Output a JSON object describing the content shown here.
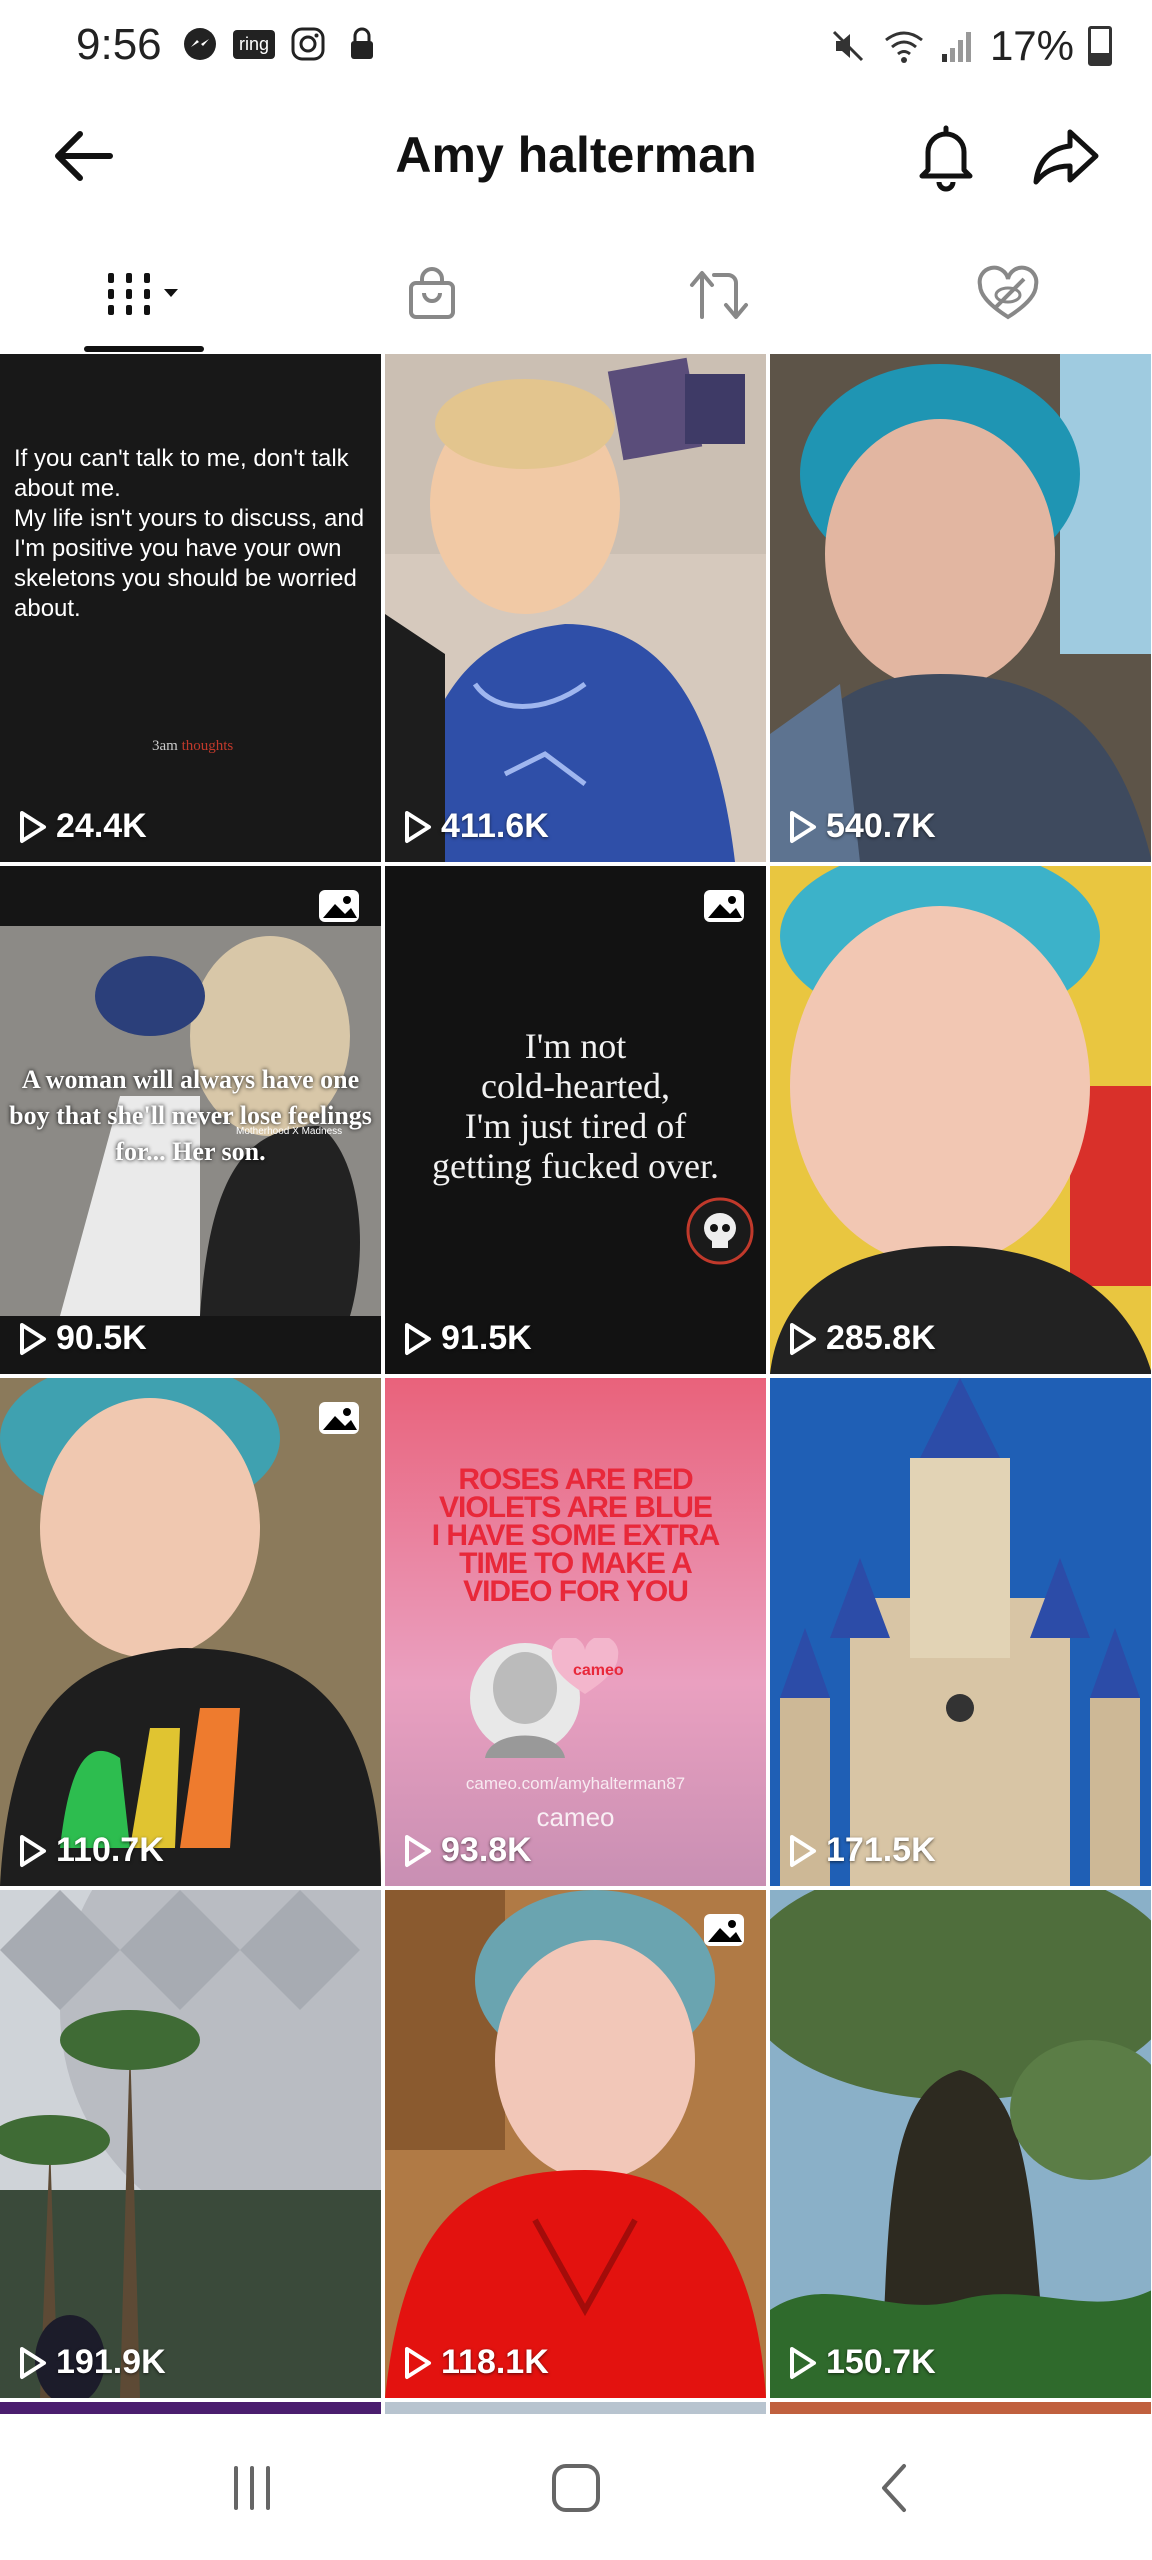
{
  "status_bar": {
    "time": "9:56",
    "ring_label": "ring",
    "battery": "17%"
  },
  "header": {
    "title": "Amy halterman"
  },
  "tabs": [
    {
      "name": "videos",
      "icon": "grid-icon"
    },
    {
      "name": "shop",
      "icon": "shopping-bag-icon"
    },
    {
      "name": "reposts",
      "icon": "repost-icon"
    },
    {
      "name": "liked",
      "icon": "hidden-heart-icon"
    }
  ],
  "posts": [
    {
      "views": "24.4K",
      "text": "If you can't talk to me, don't talk about me.\nMy life isn't yours to discuss, and I'm positive you have your own skeletons you should be worried about.",
      "watermark": "3am",
      "watermark_accent": "thoughts"
    },
    {
      "views": "411.6K"
    },
    {
      "views": "540.7K"
    },
    {
      "views": "90.5K",
      "photo": true,
      "text": "A woman will always have one boy that she'll never lose feelings for... Her son.",
      "watermark": "Motherhood X Madness"
    },
    {
      "views": "91.5K",
      "photo": true,
      "text": "I'm not\ncold-hearted,\nI'm just tired of\ngetting fucked over."
    },
    {
      "views": "285.8K"
    },
    {
      "views": "110.7K",
      "photo": true
    },
    {
      "views": "93.8K",
      "text": "ROSES ARE RED\nVIOLETS ARE BLUE\nI HAVE SOME EXTRA\nTIME TO MAKE A\nVIDEO FOR YOU",
      "url": "cameo.com/amyhalterman87",
      "brand": "cameo",
      "heart": "cameo"
    },
    {
      "views": "171.5K"
    },
    {
      "views": "191.9K"
    },
    {
      "views": "118.1K",
      "photo": true
    },
    {
      "views": "150.7K"
    }
  ],
  "colors": {
    "accent_text": "#111111",
    "cameo_red": "#e8283a"
  }
}
